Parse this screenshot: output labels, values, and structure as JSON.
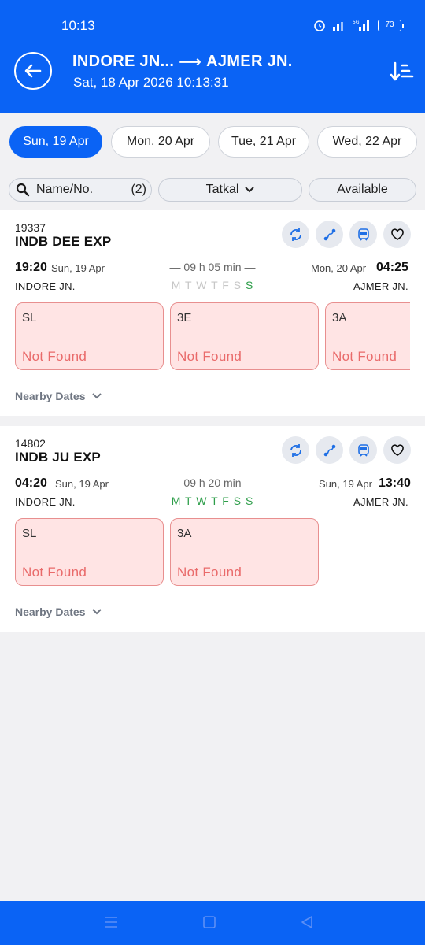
{
  "status": {
    "time": "10:13",
    "battery": "73"
  },
  "header": {
    "from": "INDORE JN...",
    "arrow": "⟶",
    "to": "AJMER JN.",
    "datetime": "Sat, 18 Apr 2026 10:13:31"
  },
  "dates": [
    "Sun, 19 Apr",
    "Mon, 20 Apr",
    "Tue, 21 Apr",
    "Wed, 22 Apr"
  ],
  "filters": {
    "search_label": "Name/No.",
    "search_count": "(2)",
    "quota": "Tatkal",
    "availability": "Available"
  },
  "trains": [
    {
      "number": "19337",
      "name": "INDB DEE EXP",
      "dep_time": "19:20",
      "dep_date": "Sun, 19 Apr",
      "duration": "— 09 h 05 min —",
      "arr_date": "Mon, 20 Apr",
      "arr_time": "04:25",
      "from_station": "INDORE JN.",
      "to_station": "AJMER JN.",
      "days": [
        "M",
        "T",
        "W",
        "T",
        "F",
        "S",
        "S"
      ],
      "classes": [
        {
          "code": "SL",
          "status": "Not Found"
        },
        {
          "code": "3E",
          "status": "Not Found"
        },
        {
          "code": "3A",
          "status": "Not Found"
        }
      ],
      "nearby": "Nearby Dates"
    },
    {
      "number": "14802",
      "name": "INDB JU EXP",
      "dep_time": "04:20",
      "dep_date": "Sun, 19 Apr",
      "duration": "— 09 h 20 min —",
      "arr_date": "Sun, 19 Apr",
      "arr_time": "13:40",
      "from_station": "INDORE JN.",
      "to_station": "AJMER JN.",
      "days": [
        "M",
        "T",
        "W",
        "T",
        "F",
        "S",
        "S"
      ],
      "classes": [
        {
          "code": "SL",
          "status": "Not Found"
        },
        {
          "code": "3A",
          "status": "Not Found"
        }
      ],
      "nearby": "Nearby Dates"
    }
  ],
  "colors": {
    "primary": "#0a63f5",
    "run_day": "#2e9e4a",
    "not_found": "#e96a6a"
  }
}
